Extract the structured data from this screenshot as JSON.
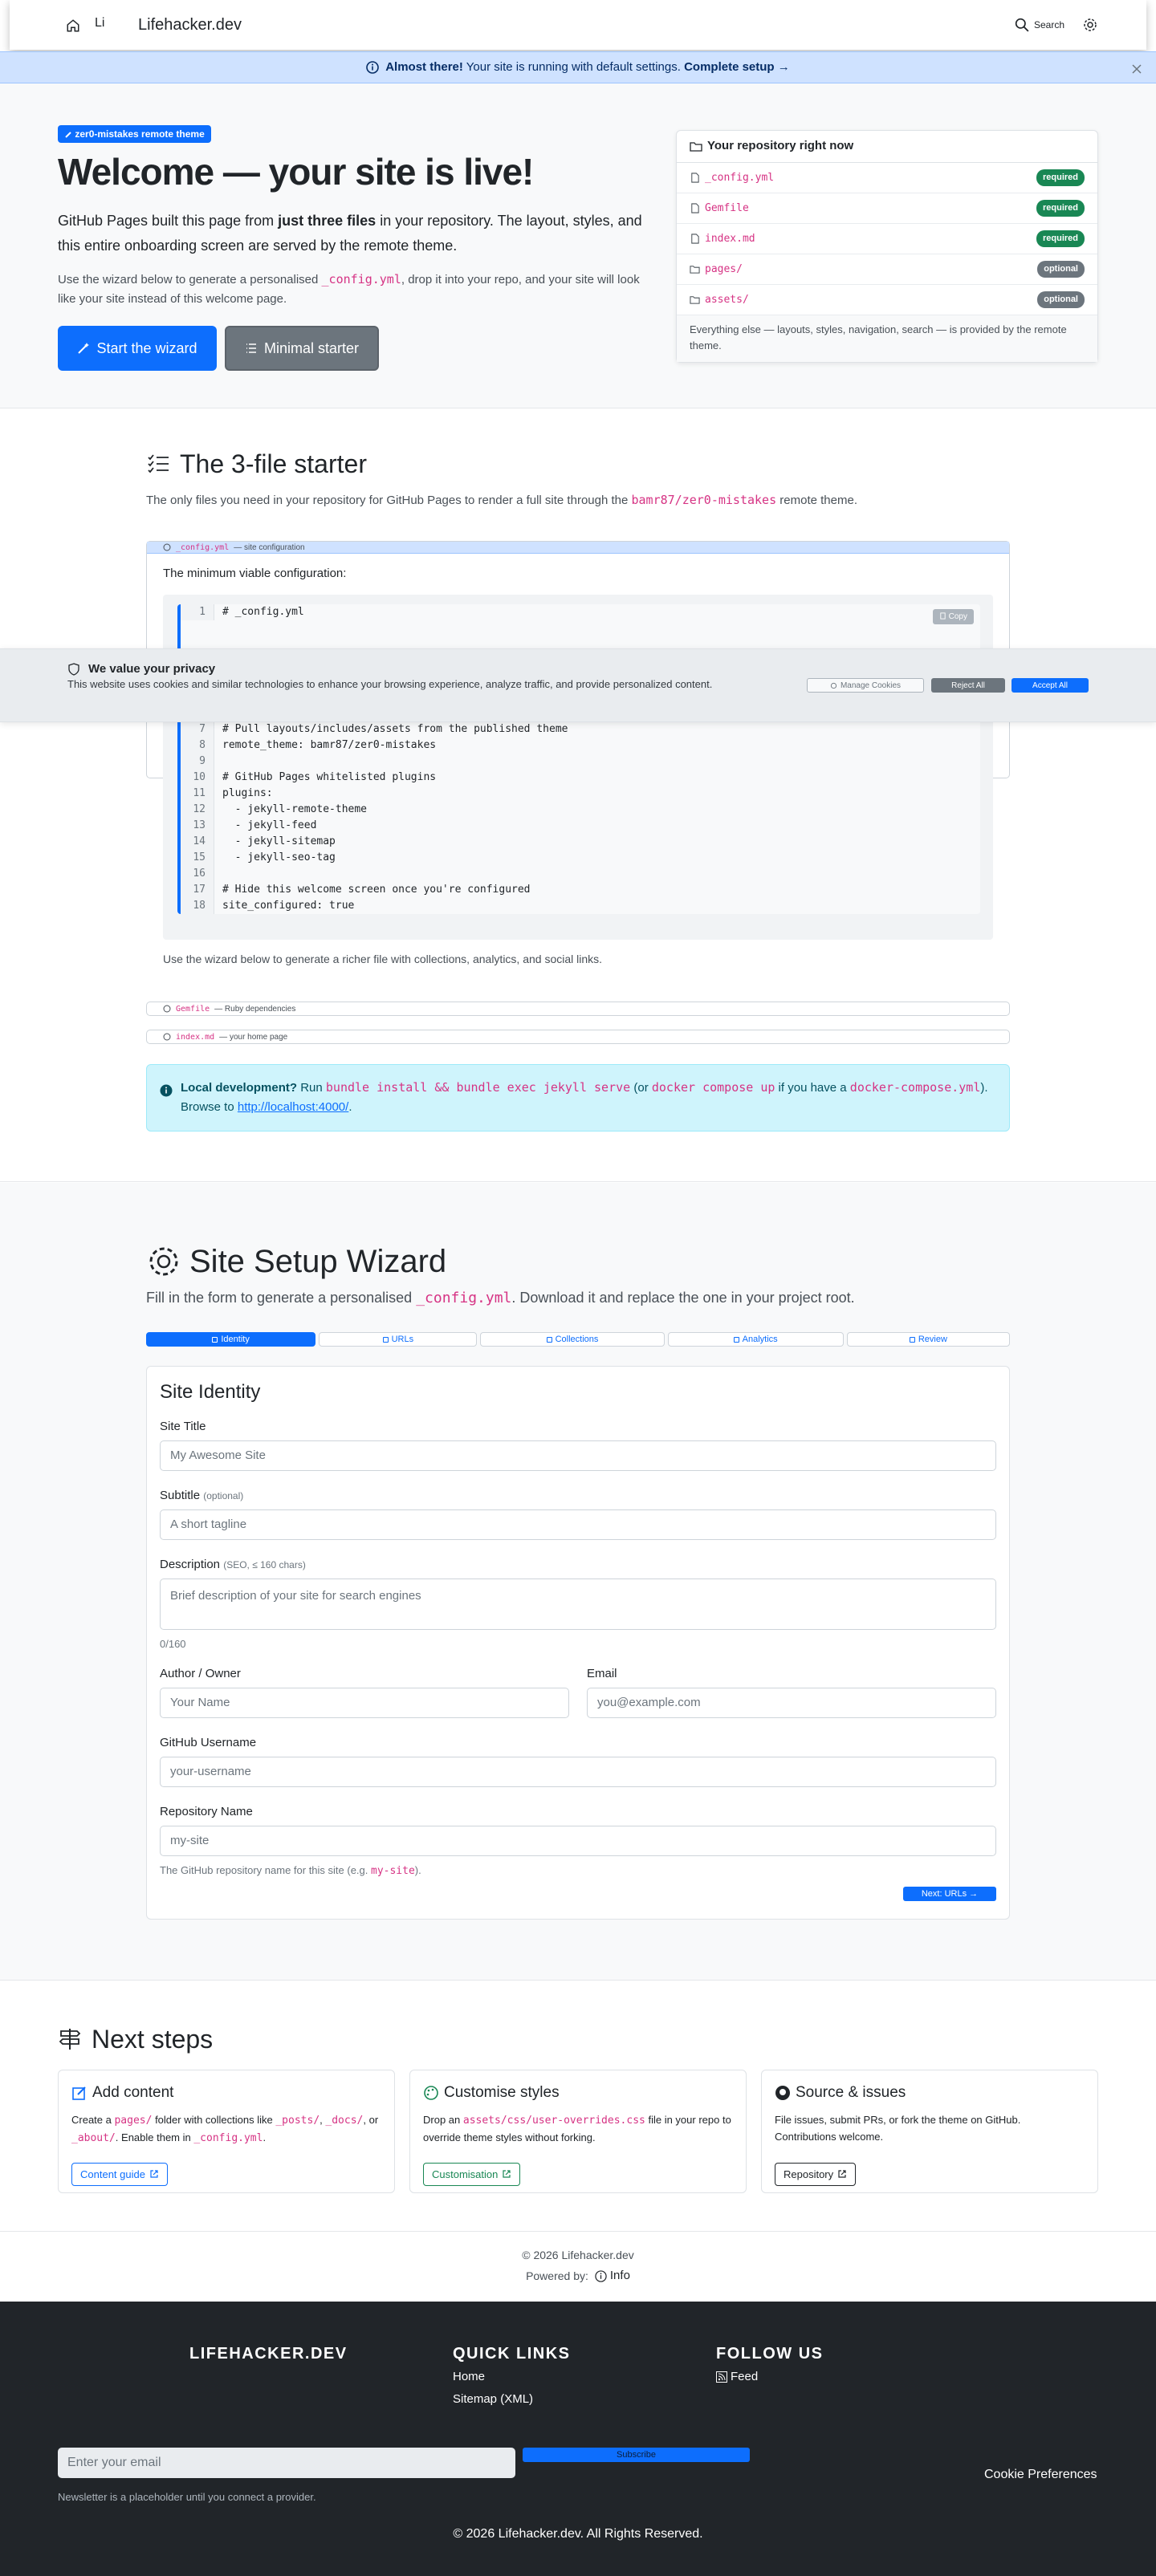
{
  "header": {
    "logo_alt": "Li",
    "brand": "Lifehacker.dev",
    "search_label": "Search"
  },
  "banner": {
    "strong": "Almost there!",
    "text": " Your site is running with default settings. ",
    "link": "Complete setup →"
  },
  "hero": {
    "badge": "zer0-mistakes remote theme",
    "title": "Welcome — your site is live!",
    "lead_pre": "GitHub Pages built this page from ",
    "lead_strong": "just three files",
    "lead_post": " in your repository. The layout, styles, and this entire onboarding screen are served by the remote theme.",
    "sub_pre": "Use the wizard below to generate a personalised ",
    "sub_code": "_config.yml",
    "sub_post": ", drop it into your repo, and your site will look like your site instead of this welcome page.",
    "primary_btn": "Start the wizard",
    "secondary_btn": "Minimal starter"
  },
  "repo": {
    "title": "Your repository right now",
    "files": [
      {
        "name": "_config.yml",
        "status": "required"
      },
      {
        "name": "Gemfile",
        "status": "required"
      },
      {
        "name": "index.md",
        "status": "required"
      },
      {
        "name": "pages/",
        "status": "optional"
      },
      {
        "name": "assets/",
        "status": "optional"
      }
    ],
    "footer": "Everything else — layouts, styles, navigation, search — is provided by the remote theme."
  },
  "starter": {
    "title": "The 3-file starter",
    "desc_pre": "The only files you need in your repository for GitHub Pages to render a full site through the ",
    "desc_code": "bamr87/zer0-mistakes",
    "desc_post": " remote theme.",
    "acc1_file": "_config.yml",
    "acc1_label": "— site configuration",
    "acc1_intro": "The minimum viable configuration:",
    "copy": "Copy",
    "code": [
      {
        "n": "1",
        "t": "# _config.yml"
      },
      {
        "n": "7",
        "t": "# Pull layouts/includes/assets from the published theme"
      },
      {
        "n": "8",
        "t": "remote_theme: bamr87/zer0-mistakes"
      },
      {
        "n": "9",
        "t": ""
      },
      {
        "n": "10",
        "t": "# GitHub Pages whitelisted plugins"
      },
      {
        "n": "11",
        "t": "plugins:"
      },
      {
        "n": "12",
        "t": "  - jekyll-remote-theme"
      },
      {
        "n": "13",
        "t": "  - jekyll-feed"
      },
      {
        "n": "14",
        "t": "  - jekyll-sitemap"
      },
      {
        "n": "15",
        "t": "  - jekyll-seo-tag"
      },
      {
        "n": "16",
        "t": ""
      },
      {
        "n": "17",
        "t": "# Hide this welcome screen once you're configured"
      },
      {
        "n": "18",
        "t": "site_configured: true"
      }
    ],
    "acc1_outro": "Use the wizard below to generate a richer file with collections, analytics, and social links.",
    "acc2_file": "Gemfile",
    "acc2_label": "— Ruby dependencies",
    "acc3_file": "index.md",
    "acc3_label": "— your home page",
    "info_strong": "Local development?",
    "info_run": " Run ",
    "info_cmd1": "bundle install && bundle exec jekyll serve",
    "info_or": " (or ",
    "info_cmd2": "docker compose up",
    "info_if": " if you have a ",
    "info_cmd3": "docker-compose.yml",
    "info_end": ").",
    "info_browse": "Browse to ",
    "info_link": "http://localhost:4000/",
    "info_dot": "."
  },
  "cookie": {
    "title": "We value your privacy",
    "message": "This website uses cookies and similar technologies to enhance your browsing experience, analyze traffic, and provide personalized content.",
    "manage": "Manage Cookies",
    "reject": "Reject All",
    "accept": "Accept All"
  },
  "wizard": {
    "title": "Site Setup Wizard",
    "desc_pre": "Fill in the form to generate a personalised ",
    "desc_code": "_config.yml",
    "desc_post": ". Download it and replace the one in your project root.",
    "tabs": [
      "Identity",
      "URLs",
      "Collections",
      "Analytics",
      "Review"
    ],
    "card_title": "Site Identity",
    "site_title_label": "Site Title",
    "site_title_ph": "My Awesome Site",
    "subtitle_label": "Subtitle",
    "subtitle_opt": "(optional)",
    "subtitle_ph": "A short tagline",
    "desc_label": "Description",
    "desc_opt": "(SEO, ≤ 160 chars)",
    "desc_ph": "Brief description of your site for search engines",
    "desc_count": "0/160",
    "author_label": "Author / Owner",
    "author_ph": "Your Name",
    "email_label": "Email",
    "email_ph": "you@example.com",
    "gh_label": "GitHub Username",
    "gh_ph": "your-username",
    "repo_label": "Repository Name",
    "repo_value": "my-site",
    "repo_hint_pre": "The GitHub repository name for this site (e.g. ",
    "repo_hint_code": "my-site",
    "repo_hint_post": ").",
    "next": "Next: URLs →"
  },
  "next_steps": {
    "title": "Next steps",
    "cards": [
      {
        "title": "Add content",
        "pre": "Create a ",
        "c1": "pages/",
        "mid": " folder with collections like ",
        "c2": "_posts/",
        "sep": ", ",
        "c3": "_docs/",
        "or": ", or ",
        "c4": "_about/",
        "post": ". Enable them in ",
        "c5": "_config.yml",
        "end": ".",
        "btn": "Content guide"
      },
      {
        "title": "Customise styles",
        "pre": "Drop an ",
        "c1": "assets/css/user-overrides.css",
        "post": " file in your repo to override theme styles without forking.",
        "btn": "Customisation"
      },
      {
        "title": "Source & issues",
        "desc": "File issues, submit PRs, or fork the theme on GitHub. Contributions welcome.",
        "btn": "Repository"
      }
    ]
  },
  "credit": {
    "copyright": "© 2026 Lifehacker.dev",
    "powered": "Powered by:",
    "info": "Info"
  },
  "footer": {
    "brand": "LIFEHACKER.DEV",
    "quick_title": "QUICK LINKS",
    "links": [
      "Home",
      "Sitemap (XML)"
    ],
    "follow_title": "FOLLOW US",
    "feed": "Feed",
    "email_ph": "Enter your email",
    "subscribe": "Subscribe",
    "note": "Newsletter is a placeholder until you connect a provider.",
    "cookie_prefs": "Cookie Preferences",
    "rights": "© 2026 Lifehacker.dev. All Rights Reserved."
  },
  "colors": {
    "primary": "#0d6efd",
    "required": "#198754",
    "optional": "#6c757d",
    "code": "#d63384",
    "footer_bg": "#212529"
  }
}
